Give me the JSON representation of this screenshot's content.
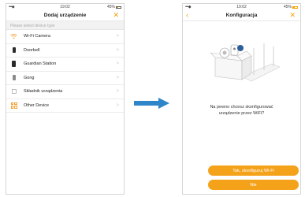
{
  "left_screen": {
    "status": {
      "time": "19:02",
      "battery": "45%"
    },
    "title": "Dodaj urządzenie",
    "close_icon": "close-icon",
    "section_header": "Please select device type",
    "devices": [
      {
        "label": "Wi-Fi Camera",
        "icon": "wifi-icon"
      },
      {
        "label": "Doorbell",
        "icon": "doorbell-icon"
      },
      {
        "label": "Guardian Station",
        "icon": "station-icon"
      },
      {
        "label": "Gong",
        "icon": "gong-icon"
      },
      {
        "label": "Składnik urządzenia",
        "icon": "component-icon"
      },
      {
        "label": "Other Device",
        "icon": "grid-icon"
      }
    ]
  },
  "arrow": {
    "color": "#2e86c8",
    "icon": "right-arrow-icon"
  },
  "right_screen": {
    "status": {
      "time": "19:02",
      "battery": "45%"
    },
    "title": "Konfiguracja",
    "back_icon": "back-icon",
    "close_icon": "close-icon",
    "question_line1": "Na pewno chcesz skonfigurować",
    "question_line2": "urządzenie przez WiFi?",
    "confirm_button": "Tak, skonfiguruj Wi-Fi",
    "cancel_button": "Nie"
  },
  "colors": {
    "accent": "#f5a000",
    "button": "#f5a21b",
    "arrow": "#2e86c8"
  }
}
